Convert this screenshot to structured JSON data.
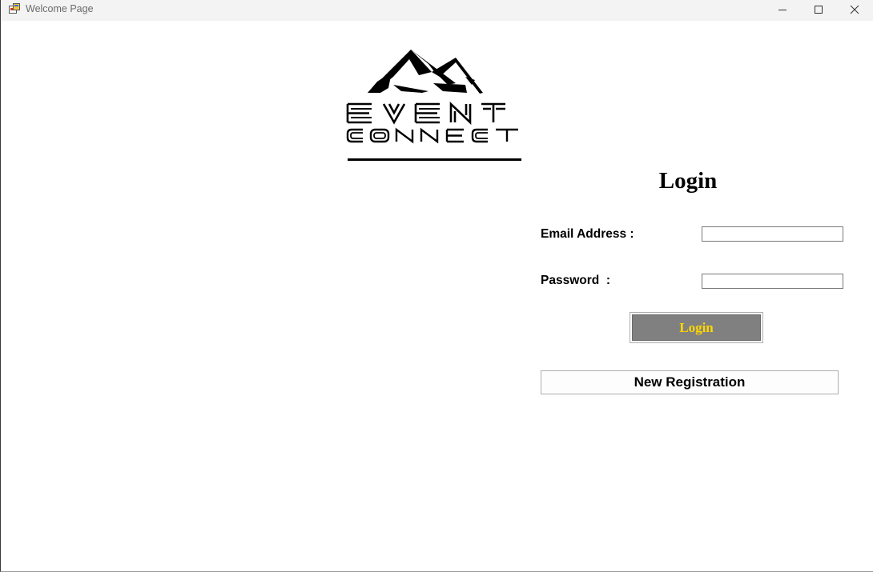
{
  "window": {
    "title": "Welcome Page",
    "controls": {
      "minimize": "minimize",
      "maximize": "maximize",
      "close": "close"
    }
  },
  "logo": {
    "line1": "EVENT",
    "line2": "CONNECT",
    "icon": "mountain-logo-icon"
  },
  "login": {
    "title": "Login",
    "email_label": "Email Address :",
    "email_value": "",
    "password_label": "Password  :",
    "password_value": "",
    "login_button": "Login",
    "register_button": "New Registration"
  },
  "colors": {
    "login_button_bg": "#808080",
    "login_button_text": "#ffd700",
    "titlebar": "#f3f3f3"
  }
}
